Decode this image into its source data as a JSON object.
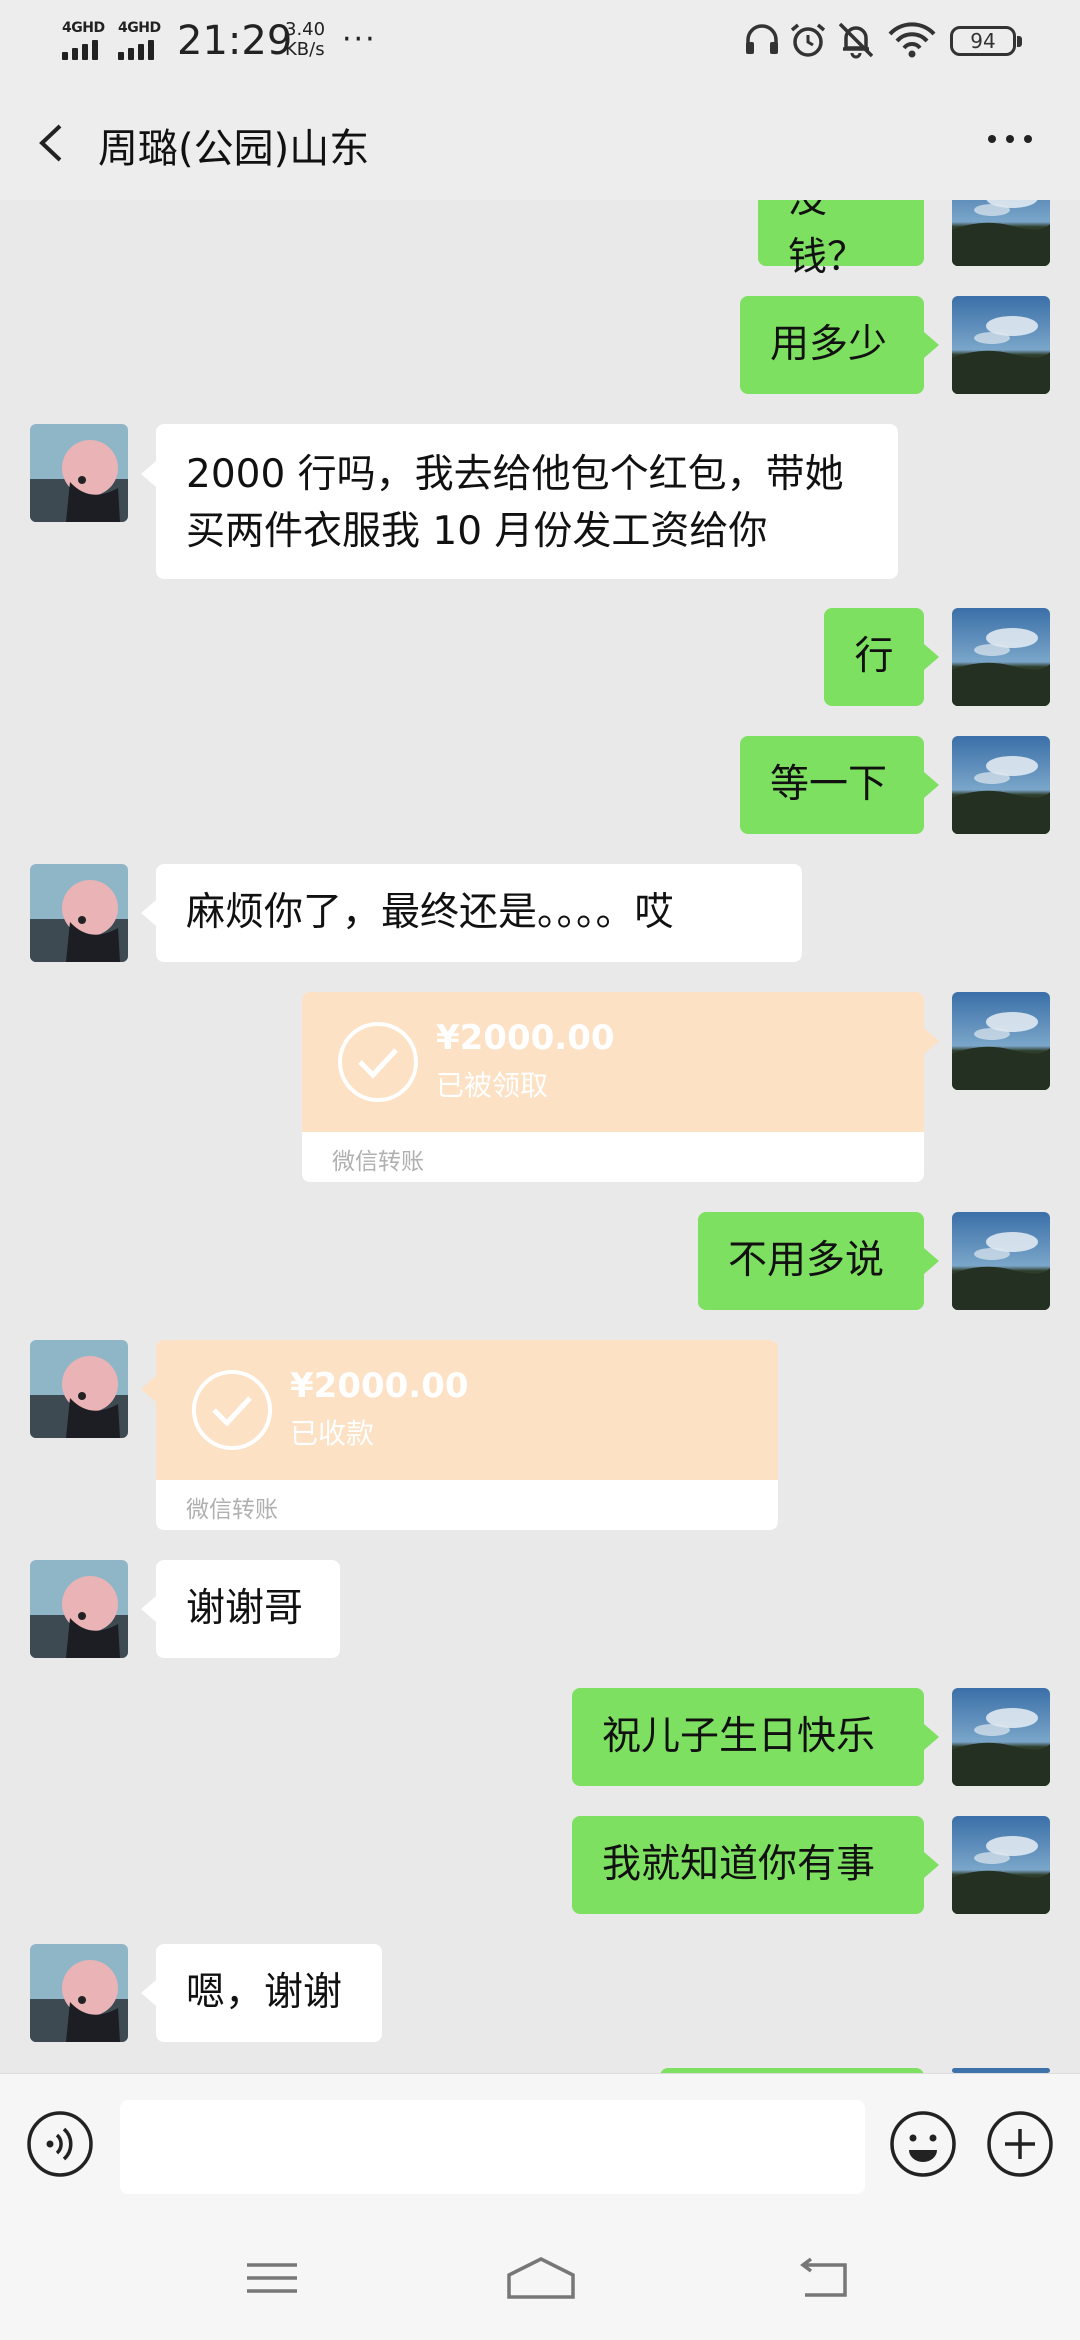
{
  "status_bar": {
    "net1": "4GHD",
    "net2": "4GHD",
    "time": "21:29",
    "speed_value": "3.40",
    "speed_unit": "KB/s",
    "overflow": "···",
    "battery": "94"
  },
  "header": {
    "title": "周璐(公园)山东"
  },
  "messages": [
    {
      "side": "right",
      "text": "没钱？"
    },
    {
      "side": "right",
      "text": "用多少"
    },
    {
      "side": "left",
      "line1": "2000 行吗，我去给他包个红包，带她",
      "line2": "买两件衣服我 10 月份发工资给你"
    },
    {
      "side": "right",
      "text": "行"
    },
    {
      "side": "right",
      "text": "等一下"
    },
    {
      "side": "left",
      "text": "麻烦你了，最终还是。。。。哎"
    },
    {
      "side": "right",
      "type": "transfer",
      "amount": "¥2000.00",
      "status": "已被领取",
      "footer": "微信转账"
    },
    {
      "side": "right",
      "text": "不用多说"
    },
    {
      "side": "left",
      "type": "transfer",
      "amount": "¥2000.00",
      "status": "已收款",
      "footer": "微信转账"
    },
    {
      "side": "left",
      "text": "谢谢哥"
    },
    {
      "side": "right",
      "text": "祝儿子生日快乐"
    },
    {
      "side": "right",
      "text": "我就知道你有事"
    },
    {
      "side": "left",
      "text": "嗯，谢谢"
    }
  ],
  "input": {
    "value": ""
  },
  "colors": {
    "sent_bubble": "#7ee060",
    "received_bubble": "#ffffff",
    "transfer_bg": "#fde1c4",
    "chat_bg": "#e9e9e9"
  }
}
